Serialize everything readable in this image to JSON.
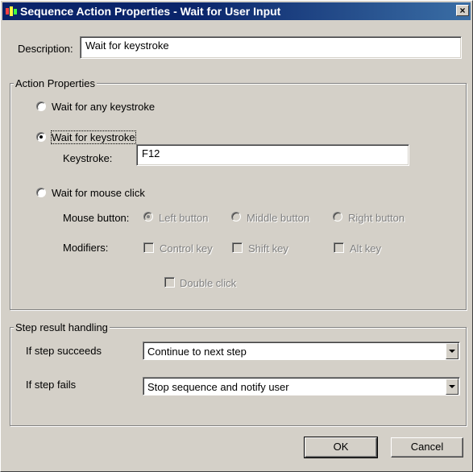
{
  "window": {
    "title": "Sequence Action Properties - Wait for User Input",
    "close_label": "×"
  },
  "description": {
    "label": "Description:",
    "value": "Wait for keystroke"
  },
  "action_properties": {
    "group_label": "Action Properties",
    "option_any_keystroke": "Wait for any keystroke",
    "option_keystroke": "Wait for keystroke",
    "selected_option": "Wait for keystroke",
    "keystroke_label": "Keystroke:",
    "keystroke_value": "F12",
    "option_mouse_click": "Wait for mouse click",
    "mouse_button_label": "Mouse button:",
    "mouse_buttons": [
      "Left button",
      "Middle button",
      "Right button"
    ],
    "modifiers_label": "Modifiers:",
    "modifiers": [
      "Control key",
      "Shift key",
      "Alt key"
    ],
    "double_click_label": "Double click"
  },
  "step_result": {
    "group_label": "Step result handling",
    "succeeds_label": "If step succeeds",
    "succeeds_value": "Continue to next step",
    "fails_label": "If step fails",
    "fails_value": "Stop sequence and notify user"
  },
  "buttons": {
    "ok": "OK",
    "cancel": "Cancel"
  }
}
